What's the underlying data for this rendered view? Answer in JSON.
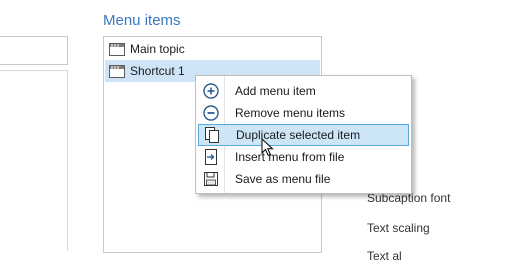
{
  "menu_items": {
    "label": "Menu items",
    "items": [
      {
        "label": "Main topic",
        "icon": "menu-item-icon",
        "selected": false
      },
      {
        "label": "Shortcut 1",
        "icon": "menu-item-icon",
        "selected": true
      }
    ]
  },
  "context_menu": {
    "items": [
      {
        "label": "Add menu item",
        "icon": "plus-circle-icon"
      },
      {
        "label": "Remove menu items",
        "icon": "minus-circle-icon"
      },
      {
        "label": "Duplicate selected item",
        "icon": "duplicate-icon",
        "highlighted": true
      },
      {
        "label": "Insert menu from file",
        "icon": "insert-file-icon"
      },
      {
        "label": "Save as menu file",
        "icon": "save-icon"
      }
    ]
  },
  "right_panel": {
    "subcaption_font": "Subcaption font",
    "text_scaling": "Text scaling",
    "text_align_partial": "Text al"
  },
  "colors": {
    "accent": "#3a78c2",
    "selection": "#cfe4f7",
    "menu_highlight": "#cde6f7",
    "menu_highlight_border": "#5aa9e0"
  }
}
